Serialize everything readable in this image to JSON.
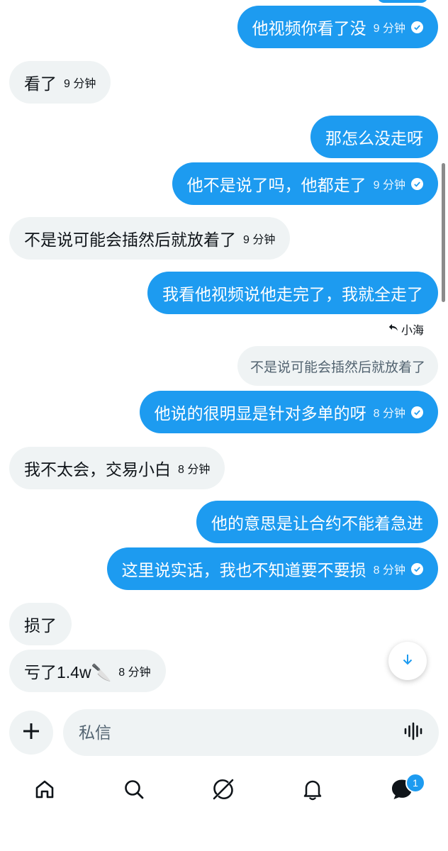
{
  "messages": [
    {
      "text": "他视频你看了没",
      "time": "9 分钟",
      "read": true
    },
    {
      "text": "看了",
      "time": "9 分钟"
    },
    {
      "text": "那怎么没走呀"
    },
    {
      "text": "他不是说了吗，他都走了",
      "time": "9 分钟",
      "read": true
    },
    {
      "text": "不是说可能会插然后就放着了",
      "time": "9 分钟"
    },
    {
      "text": "我看他视频说他走完了，我就全走了"
    },
    {
      "text": "他说的很明显是针对多单的呀",
      "time": "8 分钟",
      "read": true
    },
    {
      "text": "我不太会，交易小白",
      "time": "8 分钟"
    },
    {
      "text": "他的意思是让合约不能着急进"
    },
    {
      "text": "这里说实话，我也不知道要不要损",
      "time": "8 分钟",
      "read": true
    },
    {
      "text": "损了"
    },
    {
      "text": "亏了1.4w🔪",
      "time": "8 分钟"
    }
  ],
  "reply": {
    "to_name": "小海",
    "quoted_text": "不是说可能会插然后就放着了"
  },
  "composer": {
    "placeholder": "私信"
  },
  "nav": {
    "items": [
      "home",
      "search",
      "grok",
      "notifications",
      "messages"
    ],
    "messages_badge": "1"
  },
  "colors": {
    "accent": "#1d9bf0",
    "incoming_bg": "#eff3f4",
    "text": "#0f1419",
    "muted": "#536471"
  }
}
